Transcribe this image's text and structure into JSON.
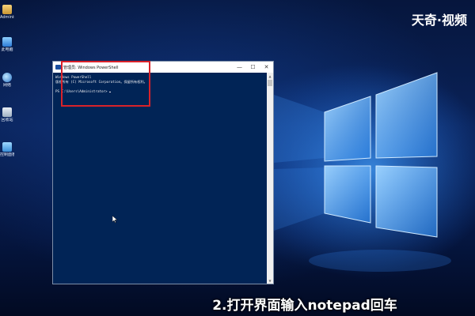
{
  "watermark": "天奇·视频",
  "desktop_icons": [
    {
      "label": "Administr...",
      "icon": "user-folder-icon"
    },
    {
      "label": "此电脑",
      "icon": "this-pc-icon"
    },
    {
      "label": "网络",
      "icon": "network-icon"
    },
    {
      "label": "回收站",
      "icon": "recycle-bin-icon"
    },
    {
      "label": "控制面板",
      "icon": "control-panel-icon"
    }
  ],
  "window": {
    "title": "管理员: Windows PowerShell",
    "minimize": "—",
    "maximize": "☐",
    "close": "✕",
    "lines": [
      "Windows PowerShell",
      "版权所有 (C) Microsoft Corporation。保留所有权利。",
      "",
      "PS C:\\Users\\Administrator>"
    ]
  },
  "subtitle": "2.打开界面输入notepad回车",
  "colors": {
    "console_bg": "#012456",
    "console_fg": "#eeedf0",
    "highlight": "#d9222a",
    "titlebar": "#ffffff"
  }
}
